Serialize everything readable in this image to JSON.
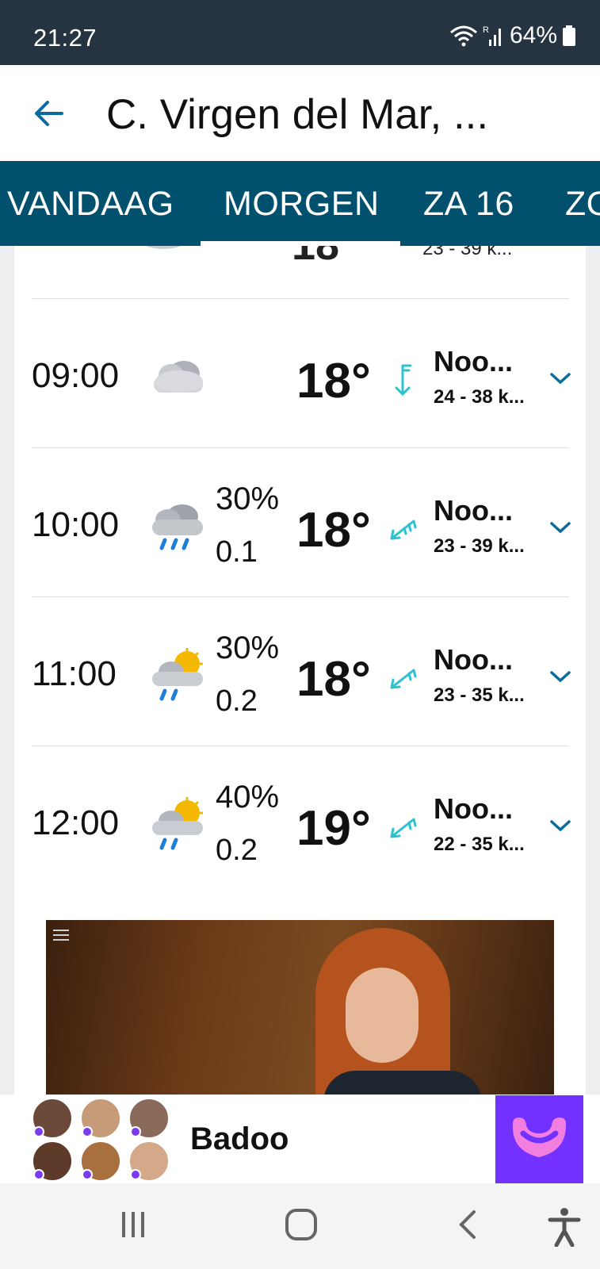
{
  "status_bar": {
    "time": "21:27",
    "battery": "64%"
  },
  "header": {
    "title": "C. Virgen del Mar, ..."
  },
  "tabs": [
    {
      "label": "VANDAAG",
      "selected": false
    },
    {
      "label": "MORGEN",
      "selected": true
    },
    {
      "label": "ZA 16",
      "selected": false
    },
    {
      "label": "ZO",
      "selected": false
    }
  ],
  "partial_row": {
    "wind_speed": "23 - 39 k..."
  },
  "hourly": [
    {
      "time": "09:00",
      "icon": "cloudy-icon",
      "precip_prob": "",
      "precip_amount": "",
      "temp": "18°",
      "wind_dir": "Noo...",
      "wind_speed": "24 - 38 k..."
    },
    {
      "time": "10:00",
      "icon": "rain-cloud-icon",
      "precip_prob": "30%",
      "precip_amount": "0.1",
      "temp": "18°",
      "wind_dir": "Noo...",
      "wind_speed": "23 - 39 k..."
    },
    {
      "time": "11:00",
      "icon": "sun-rain-cloud-icon",
      "precip_prob": "30%",
      "precip_amount": "0.2",
      "temp": "18°",
      "wind_dir": "Noo...",
      "wind_speed": "23 - 35 k..."
    },
    {
      "time": "12:00",
      "icon": "sun-rain-cloud-icon",
      "precip_prob": "40%",
      "precip_amount": "0.2",
      "temp": "19°",
      "wind_dir": "Noo...",
      "wind_speed": "22 - 35 k..."
    }
  ],
  "ad": {
    "name": "Badoo"
  },
  "colors": {
    "tab_bar": "#00506e",
    "status_bar": "#263340",
    "accent": "#0a6c9c",
    "wind_arrow": "#2cc3cf",
    "badoo": "#7331ff"
  }
}
